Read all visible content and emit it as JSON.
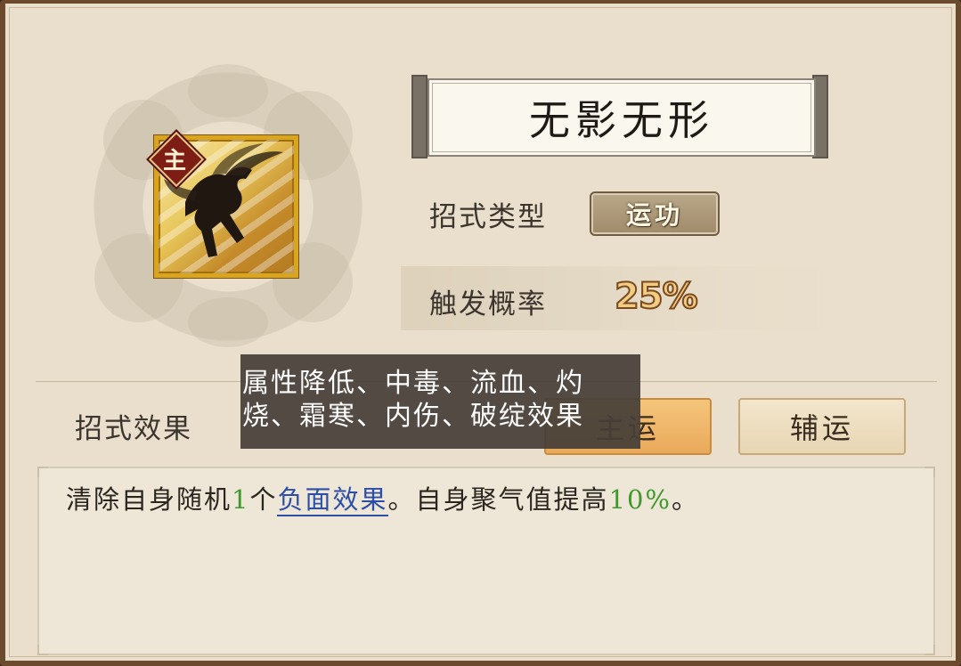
{
  "skill": {
    "name": "无影无形",
    "badge": "主",
    "type_label": "招式类型",
    "type_value": "运功",
    "rate_label": "触发概率",
    "rate_value": "25%"
  },
  "effect_section": {
    "label": "招式效果",
    "tabs": [
      {
        "label": "主运",
        "selected": true
      },
      {
        "label": "辅运",
        "selected": false
      }
    ],
    "description": {
      "prefix": "清除自身随机",
      "count": "1",
      "mid": "个",
      "link": "负面效果",
      "after_link": "。自身聚气值提高",
      "percent": "10%",
      "suffix": "。"
    }
  },
  "tooltip": {
    "text": "属性降低、中毒、流血、灼烧、霜寒、内伤、破绽效果"
  },
  "colors": {
    "frame": "#6b4a2e",
    "panel": "#e9dfcc",
    "highlight_green": "#3f9a2c",
    "link_blue": "#2b4fa8",
    "tab_selected": "#eaa95a"
  },
  "icons": {
    "skill_icon": "running-figure-icon",
    "badge_icon": "main-badge-icon"
  }
}
